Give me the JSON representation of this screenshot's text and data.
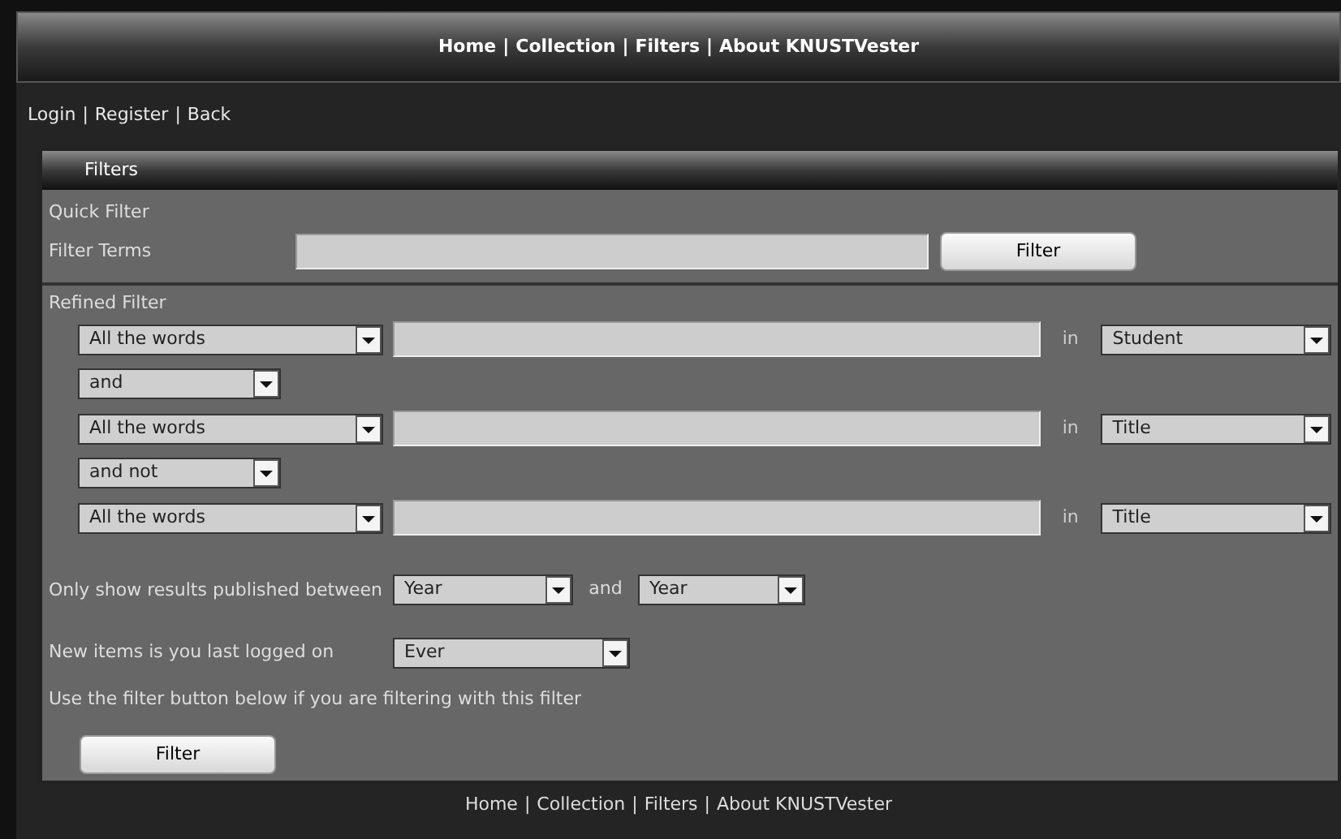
{
  "top_nav": {
    "links": [
      "Home",
      "Collection",
      "Filters",
      "About KNUSTVester"
    ],
    "separator": "|"
  },
  "account_links": {
    "links": [
      "Login",
      "Register",
      "Back"
    ],
    "separator": "|"
  },
  "panel": {
    "title": "Filters",
    "quick_filter": {
      "heading": "Quick Filter",
      "label": "Filter Terms",
      "button": "Filter"
    },
    "refined_filter": {
      "heading": "Refined Filter",
      "rows": [
        {
          "kind": "term",
          "match": "All the words",
          "in_label": "in",
          "field": "Student"
        },
        {
          "kind": "operator",
          "value": "and"
        },
        {
          "kind": "term",
          "match": "All the words",
          "in_label": "in",
          "field": "Title"
        },
        {
          "kind": "operator",
          "value": "and not"
        },
        {
          "kind": "term",
          "match": "All the words",
          "in_label": "in",
          "field": "Title"
        }
      ]
    },
    "published": {
      "label": "Only show results published between",
      "from": "Year",
      "joiner": "and",
      "to": "Year"
    },
    "new_items": {
      "label": "New items is you last logged on",
      "value": "Ever"
    },
    "hint": "Use the filter button below if you are filtering with this filter",
    "button": "Filter"
  },
  "footer": {
    "links": [
      "Home",
      "Collection",
      "Filters",
      "About KNUSTVester"
    ],
    "separator": "|"
  }
}
